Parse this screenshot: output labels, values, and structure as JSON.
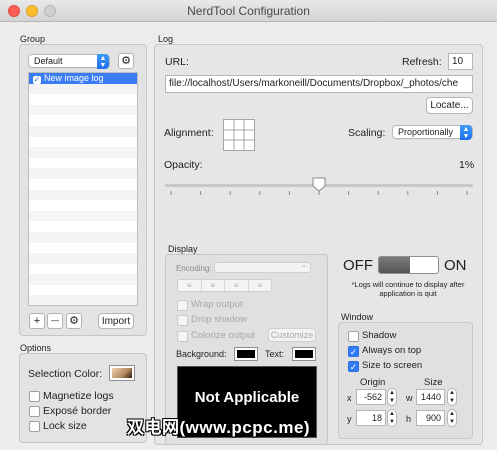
{
  "window": {
    "title": "NerdTool Configuration"
  },
  "group": {
    "heading": "Group",
    "popup_value": "Default",
    "gear_icon": "gear-icon",
    "logs": [
      {
        "label": "New image log",
        "checked": true,
        "selected": true
      }
    ],
    "add_label": "+",
    "remove_label": "—",
    "import_label": "Import"
  },
  "options": {
    "heading": "Options",
    "selection_color_label": "Selection Color:",
    "selection_color": "#d4b08c",
    "checkboxes": [
      {
        "label": "Magnetize logs",
        "checked": false
      },
      {
        "label": "Exposé border",
        "checked": false
      },
      {
        "label": "Lock size",
        "checked": false
      }
    ]
  },
  "log": {
    "heading": "Log",
    "url_label": "URL:",
    "url_value": "file://localhost/Users/markoneill/Documents/Dropbox/_photos/che",
    "refresh_label": "Refresh:",
    "refresh_value": "10",
    "locate_label": "Locate...",
    "alignment_label": "Alignment:",
    "scaling_label": "Scaling:",
    "scaling_value": "Proportionally",
    "opacity_label": "Opacity:",
    "opacity_value": "1%",
    "opacity_fraction": 0.5
  },
  "display": {
    "heading": "Display",
    "encoding_label": "Encoding:",
    "encoding_value": "",
    "checkboxes": [
      {
        "label": "Wrap output",
        "checked": false
      },
      {
        "label": "Drop shadow",
        "checked": false
      },
      {
        "label": "Colorize output",
        "checked": false
      }
    ],
    "customize_label": "Customize",
    "background_label": "Background:",
    "text_label": "Text:",
    "preview_text": "Not Applicable"
  },
  "toggle": {
    "off_label": "OFF",
    "on_label": "ON",
    "state": "off",
    "note": "*Logs will continue to display after application is quit"
  },
  "window_options": {
    "heading": "Window",
    "checkboxes": [
      {
        "label": "Shadow",
        "checked": false
      },
      {
        "label": "Always on top",
        "checked": true
      },
      {
        "label": "Size to screen",
        "checked": true
      }
    ],
    "origin_label": "Origin",
    "size_label": "Size",
    "x_label": "x",
    "y_label": "y",
    "w_label": "w",
    "h_label": "h",
    "x_value": "-562",
    "y_value": "18",
    "w_value": "1440",
    "h_value": "900"
  },
  "watermark": "双电网(www.pcpc.me)"
}
